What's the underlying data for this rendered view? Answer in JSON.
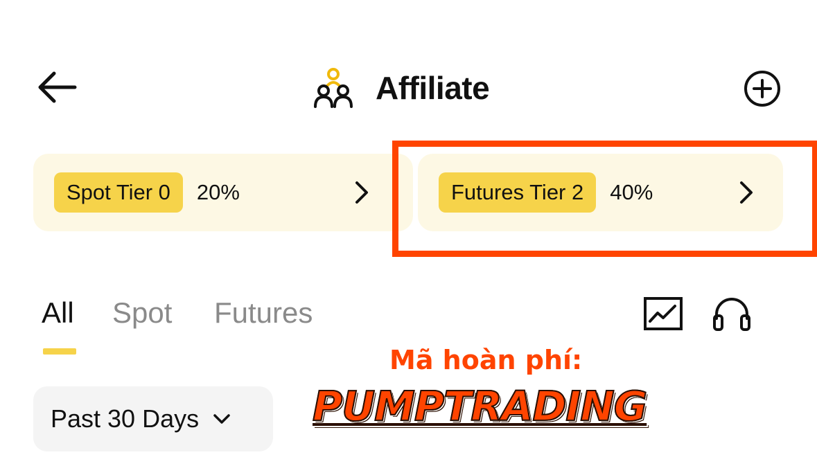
{
  "header": {
    "title": "Affiliate",
    "back_icon": "arrow-left-icon",
    "title_icon": "users-group-icon",
    "add_icon": "plus-circle-icon"
  },
  "tiers": [
    {
      "label": "Spot Tier 0",
      "percent": "20%"
    },
    {
      "label": "Futures Tier 2",
      "percent": "40%"
    }
  ],
  "tabs": [
    {
      "label": "All",
      "active": true
    },
    {
      "label": "Spot",
      "active": false
    },
    {
      "label": "Futures",
      "active": false
    }
  ],
  "toolbar_icons": [
    "line-chart-icon",
    "headset-icon"
  ],
  "promo": {
    "label": "Mã hoàn phí:",
    "code": "PUMPTRADING"
  },
  "period": {
    "selected": "Past 30 Days"
  },
  "colors": {
    "accent": "#f6d34a",
    "card_bg": "#fdf8e4",
    "highlight": "#ff4400",
    "inactive_tab": "#8a8a8a"
  }
}
